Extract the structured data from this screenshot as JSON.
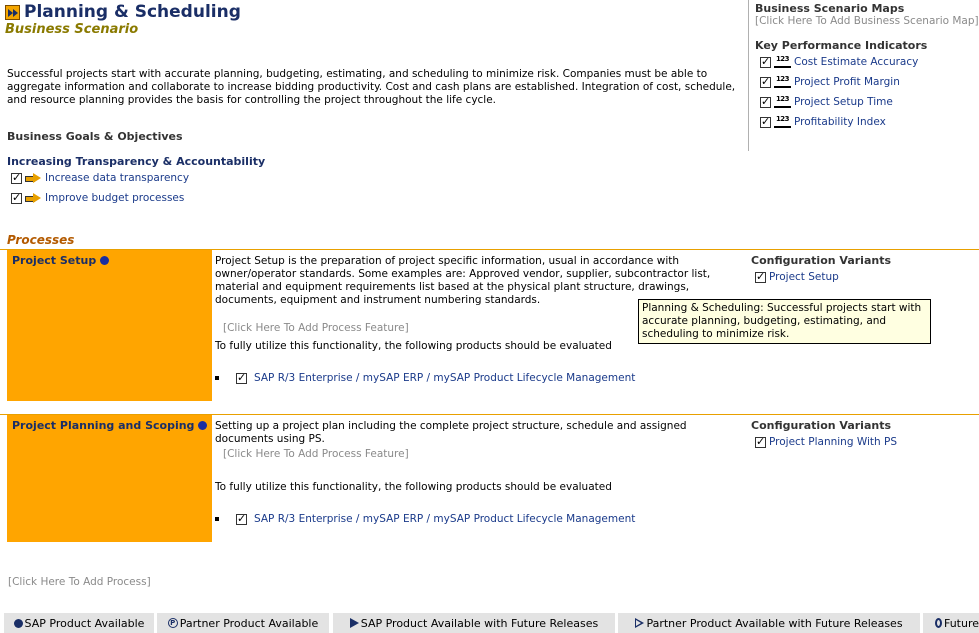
{
  "header": {
    "title": "Planning & Scheduling",
    "subtitle": "Business Scenario",
    "description": "Successful projects start with accurate planning, budgeting, estimating, and scheduling to minimize risk. Companies must be able to aggregate information and collaborate to increase bidding productivity. Cost and cash plans are established. Integration of cost, schedule, and resource planning provides the basis for controlling the project throughout the life cycle."
  },
  "right_panel": {
    "maps_heading": "Business Scenario Maps",
    "maps_placeholder": "[Click Here To Add Business Scenario Map]",
    "kpi_heading": "Key Performance Indicators",
    "kpi_icon_text": "123",
    "kpis": [
      "Cost Estimate Accuracy",
      "Project Profit Margin",
      "Project Setup Time",
      "Profitability Index"
    ]
  },
  "goals": {
    "heading": "Business Goals & Objectives",
    "group_title": "Increasing Transparency & Accountability",
    "items": [
      "Increase data transparency",
      "Improve budget processes"
    ]
  },
  "processes": {
    "heading": "Processes",
    "config_heading": "Configuration Variants",
    "eval_text": "To fully utilize this functionality, the following products should be evaluated",
    "add_feature": "[Click Here To Add Process Feature]",
    "items": [
      {
        "name": "Project Setup",
        "description": "Project Setup is the preparation of project specific information, usual in accordance with owner/operator standards. Some examples are: Approved vendor, supplier, subcontractor list, material and equipment requirements list based at the physical plant structure, drawings, documents, equipment and instrument numbering standards.",
        "product": "SAP R/3 Enterprise / mySAP ERP / mySAP Product Lifecycle Management",
        "variant": "Project Setup"
      },
      {
        "name": "Project Planning and Scoping",
        "description": "Setting up a project plan including the complete project structure, schedule and assigned documents using PS.",
        "product": "SAP R/3 Enterprise / mySAP ERP / mySAP Product Lifecycle Management",
        "variant": "Project Planning With PS"
      }
    ],
    "add_process": "[Click Here To Add Process]"
  },
  "tooltip": "Planning & Scheduling: Successful projects start with accurate planning, budgeting, estimating, and scheduling to minimize risk.",
  "legend": {
    "items": [
      "SAP Product Available",
      "Partner Product Available",
      "SAP Product Available with Future Releases",
      "Partner Product Available with Future Releases",
      "Future"
    ],
    "partner_glyph": "P"
  },
  "colors": {
    "title": "#1a2e66",
    "subtitle": "#8a7a00",
    "process_box": "#ffa500",
    "processes_heading": "#b35a00",
    "link": "#1a3a8a",
    "tooltip_bg": "#ffffe1",
    "legend_bg": "#e3e3e3"
  }
}
